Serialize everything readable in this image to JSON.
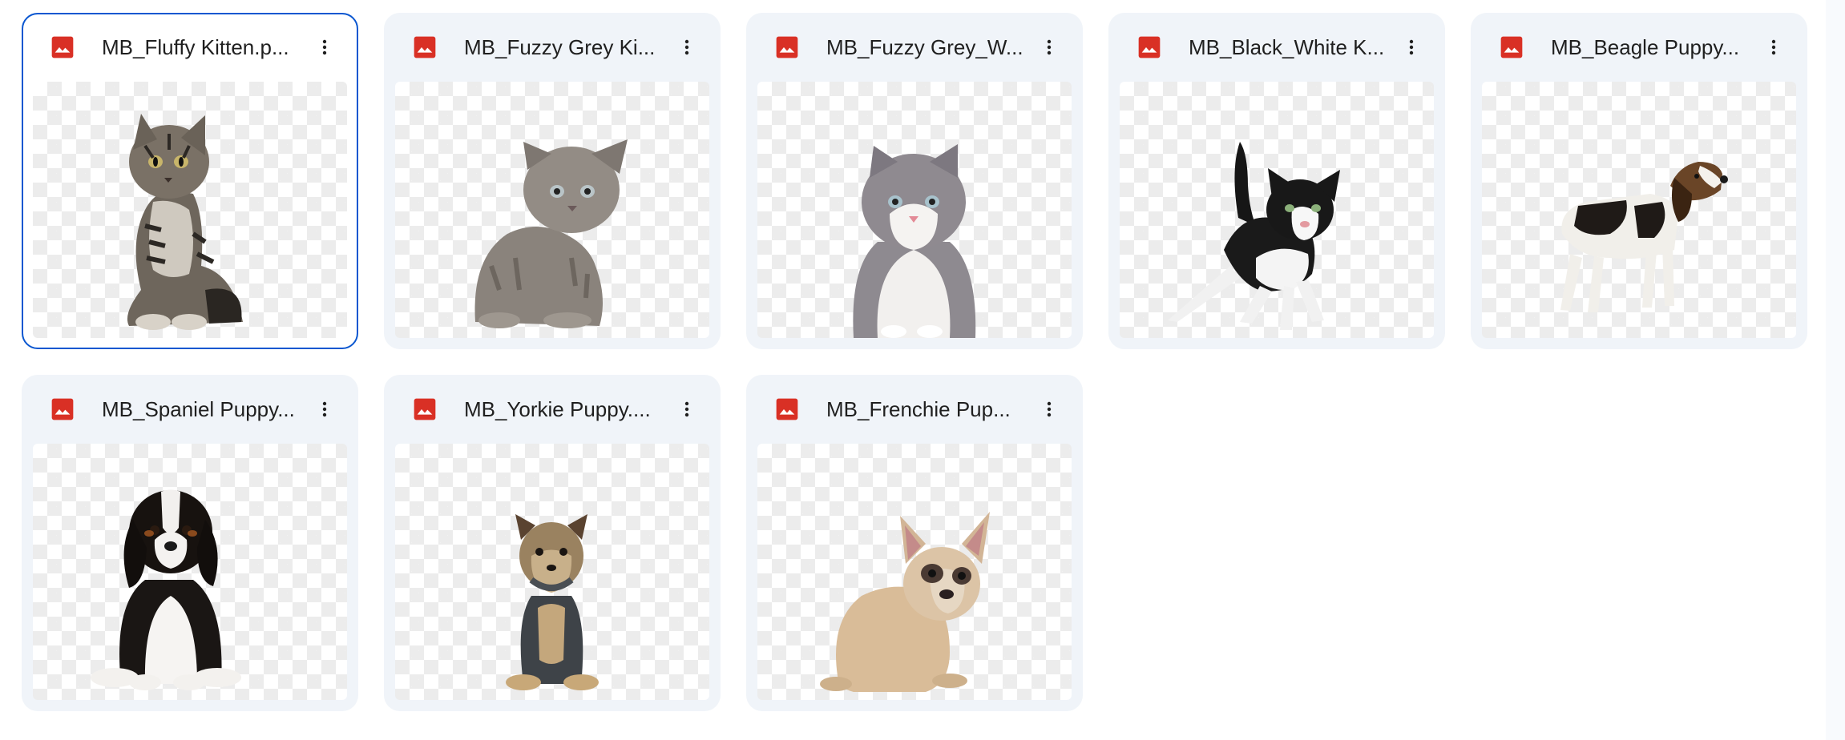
{
  "files": [
    {
      "name": "MB_Fluffy Kitten.p...",
      "type_icon": "image-file-icon",
      "selected": true,
      "animal": "tabby-kitten"
    },
    {
      "name": "MB_Fuzzy Grey Ki...",
      "type_icon": "image-file-icon",
      "selected": false,
      "animal": "grey-kitten"
    },
    {
      "name": "MB_Fuzzy Grey_W...",
      "type_icon": "image-file-icon",
      "selected": false,
      "animal": "grey-white-kitten"
    },
    {
      "name": "MB_Black_White K...",
      "type_icon": "image-file-icon",
      "selected": false,
      "animal": "black-white-kitten"
    },
    {
      "name": "MB_Beagle Puppy...",
      "type_icon": "image-file-icon",
      "selected": false,
      "animal": "beagle-puppy"
    },
    {
      "name": "MB_Spaniel Puppy...",
      "type_icon": "image-file-icon",
      "selected": false,
      "animal": "spaniel-puppy"
    },
    {
      "name": "MB_Yorkie Puppy....",
      "type_icon": "image-file-icon",
      "selected": false,
      "animal": "yorkie-puppy"
    },
    {
      "name": "MB_Frenchie Pup...",
      "type_icon": "image-file-icon",
      "selected": false,
      "animal": "frenchie-puppy"
    }
  ],
  "colors": {
    "accent": "#0b57d0",
    "image_icon": "#d93025",
    "card_bg": "#f0f4f9"
  }
}
